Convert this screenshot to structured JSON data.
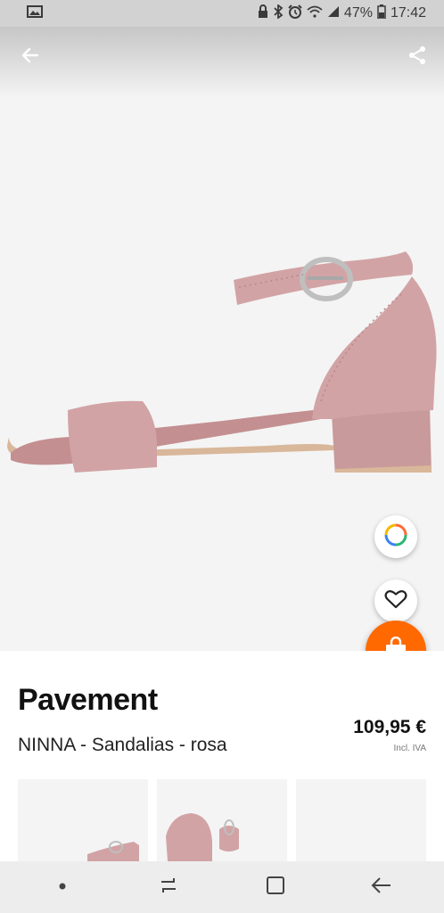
{
  "status_bar": {
    "battery_text": "47%",
    "time": "17:42"
  },
  "product": {
    "brand": "Pavement",
    "name": "NINNA - Sandalias - rosa",
    "price": "109,95 €",
    "tax_note": "Incl. IVA",
    "color": "#d2a3a5"
  },
  "colors": {
    "accent": "#ff6900"
  },
  "thumbnails": [
    "thumb-1",
    "thumb-2",
    "thumb-3"
  ]
}
